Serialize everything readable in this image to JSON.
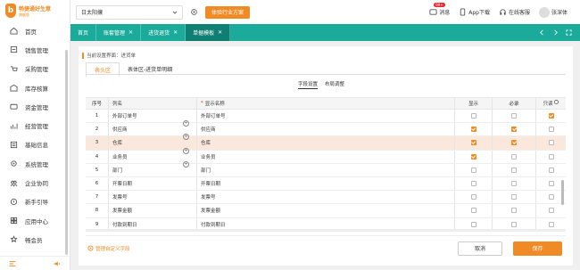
{
  "brand": {
    "mark": "b",
    "name": "畅捷通好生意",
    "sub": "旗舰版",
    "color": "#f08a24"
  },
  "sidebar": {
    "items": [
      {
        "label": "首页",
        "icon": "home-icon"
      },
      {
        "label": "销售管理",
        "icon": "sales-icon"
      },
      {
        "label": "采购管理",
        "icon": "purchase-icon"
      },
      {
        "label": "库存核算",
        "icon": "inventory-icon"
      },
      {
        "label": "资金管理",
        "icon": "funds-icon"
      },
      {
        "label": "经营管理",
        "icon": "business-icon"
      },
      {
        "label": "基础信息",
        "icon": "basic-info-icon"
      },
      {
        "label": "系统管理",
        "icon": "system-icon"
      },
      {
        "label": "企业协同",
        "icon": "collab-icon"
      },
      {
        "label": "新手引导",
        "icon": "guide-icon"
      },
      {
        "label": "应用中心",
        "icon": "apps-icon"
      },
      {
        "label": "畅会员",
        "icon": "member-icon"
      }
    ]
  },
  "topbar": {
    "company": "日太阳攘",
    "experience_button": "体验行业方案",
    "messages": {
      "label": "消息",
      "badge": "99+"
    },
    "app_download": "App下载",
    "online_service": "在线客服",
    "user": "张深体"
  },
  "tabs": [
    {
      "label": "首页",
      "closable": false,
      "active": false
    },
    {
      "label": "账套管理",
      "closable": true,
      "active": false
    },
    {
      "label": "进货退货",
      "closable": true,
      "active": false
    },
    {
      "label": "单据模板",
      "closable": true,
      "active": true
    }
  ],
  "breadcrumb": "当前设置界面：进货单",
  "subtabs": [
    "表头区",
    "表体区-进货单明细"
  ],
  "mini_tabs": [
    "字段设置",
    "布局调整"
  ],
  "table": {
    "headers": {
      "no": "序号",
      "name": "列名",
      "display": "显示名称",
      "display_req": "*",
      "show": "显示",
      "required": "必录",
      "readonly": "只读"
    },
    "rows": [
      {
        "no": "1",
        "name": "外部订单号",
        "display": "外部订单号",
        "show": false,
        "required": false,
        "readonly": true,
        "plus": false
      },
      {
        "no": "2",
        "name": "供应商",
        "display": "供应商",
        "show": true,
        "required": true,
        "readonly": false,
        "plus": true
      },
      {
        "no": "3",
        "name": "仓库",
        "display": "仓库",
        "show": true,
        "required": true,
        "readonly": false,
        "plus": true,
        "highlight": true
      },
      {
        "no": "4",
        "name": "业务员",
        "display": "业务员",
        "show": true,
        "required": false,
        "readonly": false,
        "plus": true
      },
      {
        "no": "5",
        "name": "部门",
        "display": "部门",
        "show": false,
        "required": false,
        "readonly": false,
        "plus": true
      },
      {
        "no": "6",
        "name": "开票日期",
        "display": "开票日期",
        "show": false,
        "required": false,
        "readonly": false,
        "plus": false
      },
      {
        "no": "7",
        "name": "发票号",
        "display": "发票号",
        "show": false,
        "required": false,
        "readonly": false,
        "plus": false
      },
      {
        "no": "8",
        "name": "发票金额",
        "display": "发票金额",
        "show": false,
        "required": false,
        "readonly": false,
        "plus": false
      },
      {
        "no": "9",
        "name": "付款到期日",
        "display": "付款到期日",
        "show": false,
        "required": false,
        "readonly": false,
        "plus": false
      }
    ]
  },
  "footer": {
    "manage_link": "管理自定义字段",
    "cancel": "取消",
    "save": "保存"
  }
}
